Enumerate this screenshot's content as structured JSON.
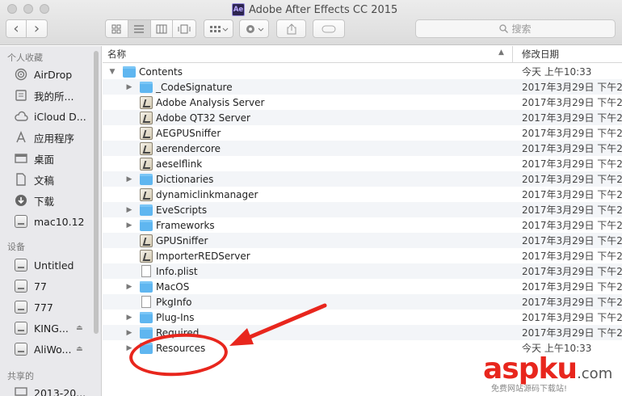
{
  "window": {
    "title": "Adobe After Effects CC 2015",
    "app_badge": "Ae"
  },
  "toolbar": {
    "back_icon": "‹",
    "forward_icon": "›",
    "search_placeholder": "搜索"
  },
  "sidebar": {
    "sections": [
      {
        "heading": "个人收藏"
      },
      {
        "heading": "设备"
      },
      {
        "heading": "共享的"
      }
    ],
    "favorites": [
      {
        "label": "AirDrop",
        "icon": "airdrop-icon"
      },
      {
        "label": "我的所...",
        "icon": "all-files-icon"
      },
      {
        "label": "iCloud D...",
        "icon": "icloud-icon"
      },
      {
        "label": "应用程序",
        "icon": "applications-icon"
      },
      {
        "label": "桌面",
        "icon": "desktop-icon"
      },
      {
        "label": "文稿",
        "icon": "documents-icon"
      },
      {
        "label": "下载",
        "icon": "downloads-icon"
      },
      {
        "label": "mac10.12",
        "icon": "folder-icon"
      }
    ],
    "devices": [
      {
        "label": "Untitled",
        "icon": "disk-icon",
        "eject": false
      },
      {
        "label": "77",
        "icon": "disk-icon",
        "eject": false
      },
      {
        "label": "777",
        "icon": "disk-icon",
        "eject": false
      },
      {
        "label": "KING...",
        "icon": "disk-icon",
        "eject": true
      },
      {
        "label": "AliWo...",
        "icon": "disk-icon",
        "eject": true
      }
    ],
    "shared": [
      {
        "label": "2013-20...",
        "icon": "display-icon"
      }
    ]
  },
  "columns": {
    "name": "名称",
    "date": "修改日期"
  },
  "files": [
    {
      "name": "Contents",
      "type": "folder",
      "level": 0,
      "disclosure": "open",
      "date": "今天 上午10:33"
    },
    {
      "name": "_CodeSignature",
      "type": "folder",
      "level": 1,
      "disclosure": "closed",
      "date": "2017年3月29日 下午2:"
    },
    {
      "name": "Adobe Analysis Server",
      "type": "exec",
      "level": 1,
      "disclosure": "none",
      "date": "2017年3月29日 下午2:"
    },
    {
      "name": "Adobe QT32 Server",
      "type": "exec",
      "level": 1,
      "disclosure": "none",
      "date": "2017年3月29日 下午2:"
    },
    {
      "name": "AEGPUSniffer",
      "type": "exec",
      "level": 1,
      "disclosure": "none",
      "date": "2017年3月29日 下午2:"
    },
    {
      "name": "aerendercore",
      "type": "exec",
      "level": 1,
      "disclosure": "none",
      "date": "2017年3月29日 下午2:"
    },
    {
      "name": "aeselflink",
      "type": "exec",
      "level": 1,
      "disclosure": "none",
      "date": "2017年3月29日 下午2:"
    },
    {
      "name": "Dictionaries",
      "type": "folder",
      "level": 1,
      "disclosure": "closed",
      "date": "2017年3月29日 下午2:"
    },
    {
      "name": "dynamiclinkmanager",
      "type": "exec",
      "level": 1,
      "disclosure": "none",
      "date": "2017年3月29日 下午2:"
    },
    {
      "name": "EveScripts",
      "type": "folder",
      "level": 1,
      "disclosure": "closed",
      "date": "2017年3月29日 下午2:"
    },
    {
      "name": "Frameworks",
      "type": "folder",
      "level": 1,
      "disclosure": "closed",
      "date": "2017年3月29日 下午2:"
    },
    {
      "name": "GPUSniffer",
      "type": "exec",
      "level": 1,
      "disclosure": "none",
      "date": "2017年3月29日 下午2:"
    },
    {
      "name": "ImporterREDServer",
      "type": "exec",
      "level": 1,
      "disclosure": "none",
      "date": "2017年3月29日 下午2:"
    },
    {
      "name": "Info.plist",
      "type": "doc",
      "level": 1,
      "disclosure": "none",
      "date": "2017年3月29日 下午2:"
    },
    {
      "name": "MacOS",
      "type": "folder",
      "level": 1,
      "disclosure": "closed",
      "date": "2017年3月29日 下午2:"
    },
    {
      "name": "PkgInfo",
      "type": "doc",
      "level": 1,
      "disclosure": "none",
      "date": "2017年3月29日 下午2:"
    },
    {
      "name": "Plug-Ins",
      "type": "folder",
      "level": 1,
      "disclosure": "closed",
      "date": "2017年3月29日 下午2:"
    },
    {
      "name": "Required",
      "type": "folder",
      "level": 1,
      "disclosure": "closed",
      "date": "2017年3月29日 下午2:"
    },
    {
      "name": "Resources",
      "type": "folder",
      "level": 1,
      "disclosure": "closed",
      "date": "今天 上午10:33"
    }
  ],
  "watermark": {
    "brand_main": "aspku",
    "brand_suffix": ".com",
    "tagline": "免费网站源码下载站!"
  },
  "colors": {
    "annotation_red": "#e8261d",
    "folder_blue": "#5fb6f0"
  }
}
